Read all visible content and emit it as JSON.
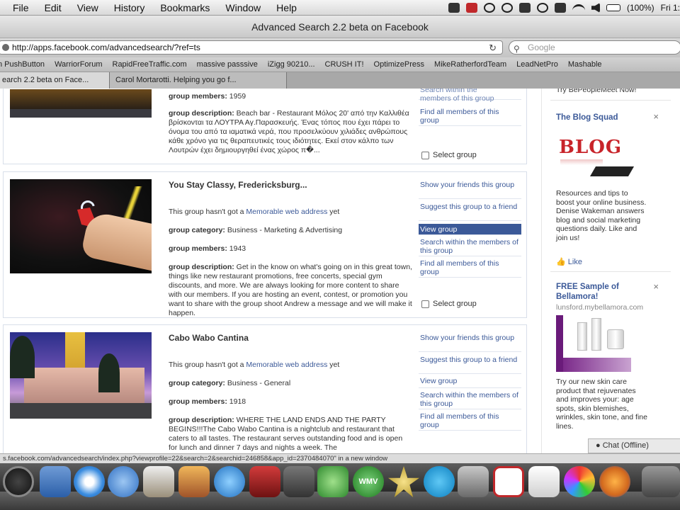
{
  "menubar": {
    "items": [
      "File",
      "Edit",
      "View",
      "History",
      "Bookmarks",
      "Window",
      "Help"
    ],
    "battery": "(100%)",
    "clock": "Fri 1:"
  },
  "window": {
    "title": "Advanced Search 2.2 beta on Facebook"
  },
  "toolbar": {
    "url": "http://apps.facebook.com/advancedsearch/?ref=ts",
    "search_placeholder": "Google"
  },
  "bookmarks": [
    "n PushButton",
    "WarriorForum",
    "RapidFreeTraffic.com",
    "massive passsive",
    "iZigg 90210...",
    "CRUSH IT!",
    "OptimizePress",
    "MikeRatherfordTeam",
    "LeadNetPro",
    "Mashable"
  ],
  "tabs": [
    {
      "label": "earch 2.2 beta on Face..."
    },
    {
      "label": "Carol Mortarotti. Helping you go f..."
    }
  ],
  "groups": [
    {
      "members_label": "group members:",
      "members": "1959",
      "description_label": "group description:",
      "description": "Beach bar - Restaurant Μόλος 20' από την Καλλιθέα βρίσκονται τα ΛΟΥΤΡΑ Αγ.Παρασκευής. Ένας τόπος που έχει πάρει το όνομα του από τα ιαματικά νερά, που προσελκύουν χιλιάδες ανθρώπους κάθε χρόνο για τις θεραπευτικές τους ιδιότητες. Εκεί στον κάλπο των Λουτρών έχει δημιουργηθεί ένας χώρος π�...",
      "actions": [
        "members of this group",
        "Find all members of this group"
      ],
      "action_partial": "Search within the",
      "select_label": "Select group"
    },
    {
      "name": "You Stay Classy, Fredericksburg...",
      "web_prefix": "This group hasn't got a ",
      "web_link": "Memorable web address",
      "web_suffix": " yet",
      "category_label": "group category:",
      "category": "Business - Marketing & Advertising",
      "members_label": "group members:",
      "members": "1943",
      "description_label": "group description:",
      "description": "Get in the know on what's going on in this great town, things like new restaurant promotions, free concerts, special gym discounts, and more. We are always looking for more content to share with our members. If you are hosting an event, contest, or promotion you want to share with the group shoot Andrew a message and we will make it happen.",
      "actions": [
        "Show your friends this group",
        "Suggest this group to a friend",
        "View group",
        "Search within the members of this group",
        "Find all members of this group"
      ],
      "select_label": "Select group"
    },
    {
      "name": "Cabo Wabo Cantina",
      "web_prefix": "This group hasn't got a ",
      "web_link": "Memorable web address",
      "web_suffix": " yet",
      "category_label": "group category:",
      "category": "Business - General",
      "members_label": "group members:",
      "members": "1918",
      "description_label": "group description:",
      "description": "WHERE THE LAND ENDS AND THE PARTY BEGINS!!!The Cabo Wabo Cantina is a nightclub and restaurant that caters to all tastes. The restaurant serves outstanding food and is open for lunch and dinner 7 days and nights a week. The",
      "actions": [
        "Show your friends this group",
        "Suggest this group to a friend",
        "View group",
        "Search within the members of this group",
        "Find all members of this group"
      ]
    }
  ],
  "sidebar": {
    "top_partial": "Try BePeopleMeet Now!",
    "ad1": {
      "title": "The Blog Squad",
      "image_text": "BLOG",
      "body": "Resources and tips to boost your online business. Denise Wakeman answers blog and social marketing questions daily. Like and join us!",
      "like": "Like"
    },
    "ad2": {
      "title": "FREE Sample of Bellamora!",
      "domain": "lunsford.mybellamora.com",
      "body": "Try our new skin care product that rejuvenates and improves your: age spots, skin blemishes, wrinkles, skin tone, and fine lines."
    },
    "chat": "Chat (Offline)"
  },
  "statusbar": {
    "text": "s.facebook.com/advancedsearch/index.php?viewprofile=22&search=2&searchid=246858&app_id=2370484070\" in a new window"
  },
  "dock": {
    "wmv_label": "WMV"
  },
  "colors": {
    "facebook_blue": "#3b5998",
    "hover_bg": "#3b5998"
  }
}
